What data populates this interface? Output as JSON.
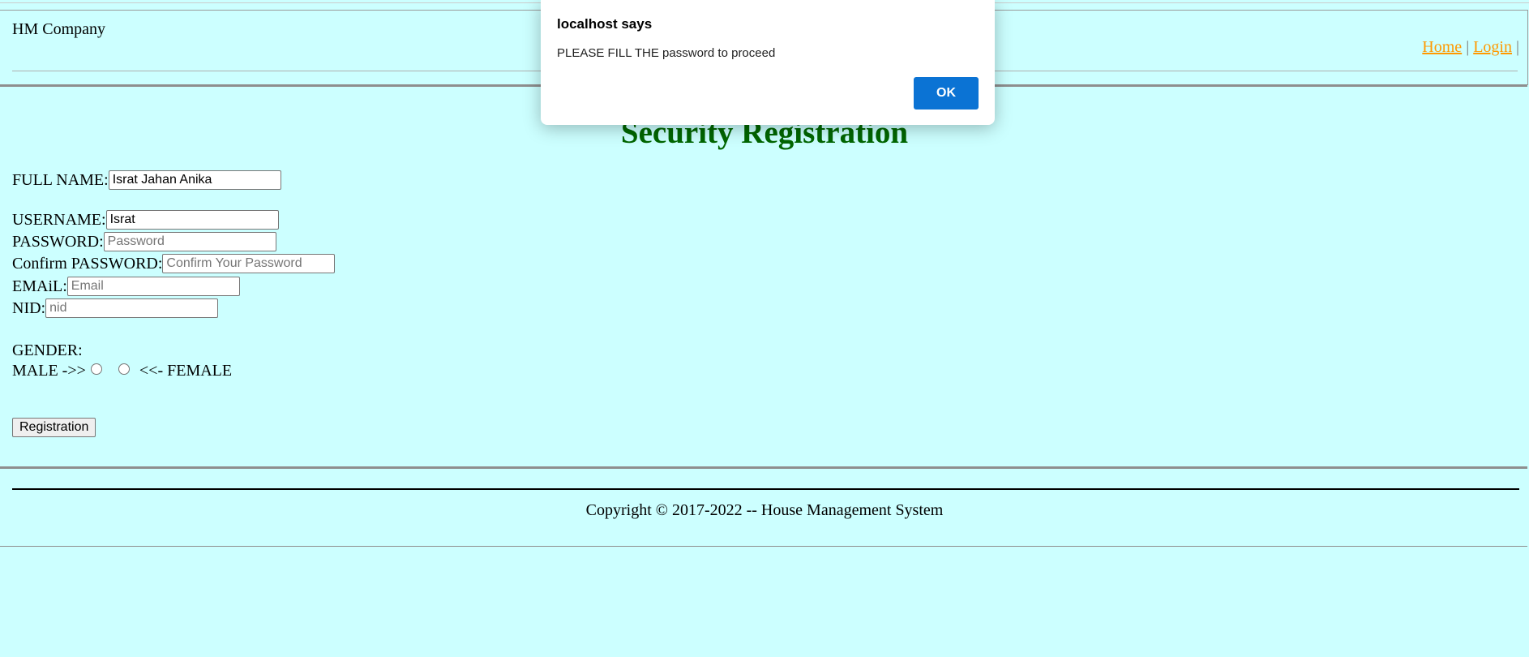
{
  "header": {
    "brand": "HM Company",
    "nav": {
      "home": "Home",
      "login": "Login",
      "separator": "|"
    }
  },
  "form": {
    "title": "Security Registration",
    "full_name": {
      "label": "FULL NAME:",
      "value": "Israt Jahan Anika"
    },
    "username": {
      "label": "USERNAME:",
      "value": "Israt"
    },
    "password": {
      "label": "PASSWORD:",
      "placeholder": "Password"
    },
    "confirm_password": {
      "label": "Confirm PASSWORD:",
      "placeholder": "Confirm Your Password"
    },
    "email": {
      "label": "EMAiL:",
      "placeholder": "Email"
    },
    "nid": {
      "label": "NID:",
      "placeholder": "nid"
    },
    "gender": {
      "label": "GENDER:",
      "male": "MALE ->>",
      "female": "<<- FEMALE"
    },
    "submit_label": "Registration"
  },
  "footer": {
    "copyright": "Copyright © 2017-2022 -- House Management System"
  },
  "dialog": {
    "title": "localhost says",
    "message": "PLEASE FILL THE password to proceed",
    "ok_label": "OK"
  },
  "colors": {
    "background": "#ccffff",
    "title": "#006600",
    "nav_link": "#ff9900",
    "ok_button": "#0b73d4"
  }
}
